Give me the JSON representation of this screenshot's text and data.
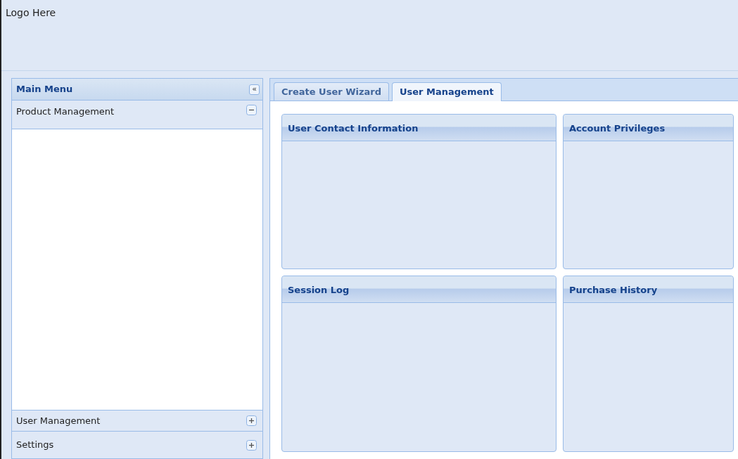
{
  "header": {
    "logo": "Logo Here"
  },
  "sidebar": {
    "title": "Main Menu",
    "collapse_icon": "«",
    "items": [
      {
        "label": "Product Management",
        "expanded": true
      },
      {
        "label": "User Management",
        "expanded": false
      },
      {
        "label": "Settings",
        "expanded": false
      }
    ]
  },
  "tabs": [
    {
      "label": "Create User Wizard",
      "selected": false
    },
    {
      "label": "User Management",
      "selected": true
    }
  ],
  "portlets": [
    {
      "title": "User Contact Information"
    },
    {
      "title": "Account Privileges"
    },
    {
      "title": "Session Log"
    },
    {
      "title": "Purchase History"
    }
  ]
}
